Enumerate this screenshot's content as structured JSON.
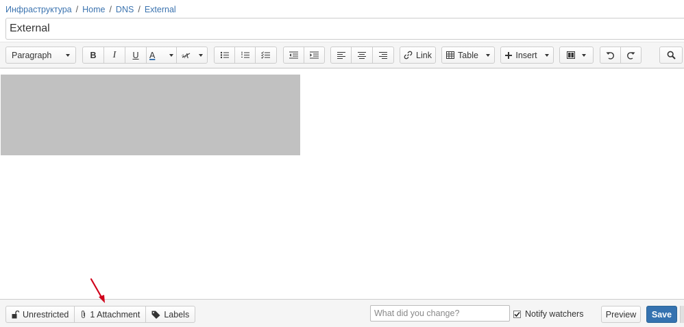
{
  "breadcrumb": [
    "Инфраструктура",
    "Home",
    "DNS",
    "External"
  ],
  "title": "External",
  "toolbar": {
    "paragraph": "Paragraph",
    "bold": "B",
    "italic": "I",
    "underline": "U",
    "text_color": "A",
    "link": "Link",
    "table": "Table",
    "insert": "Insert"
  },
  "footer": {
    "restrictions": "Unrestricted",
    "attachments": "1 Attachment",
    "labels": "Labels",
    "change_placeholder": "What did you change?",
    "notify": "Notify watchers",
    "notify_checked": true,
    "preview": "Preview",
    "save": "Save"
  },
  "colors": {
    "link": "#3b73af",
    "save": "#3572b0",
    "annotation_arrow": "#d0021b",
    "placeholder_image": "#c1c1c1"
  }
}
